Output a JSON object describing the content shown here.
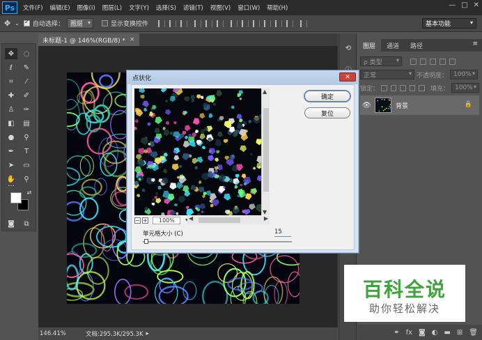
{
  "app": {
    "logo": "Ps"
  },
  "menu": [
    "文件(F)",
    "编辑(E)",
    "图像(I)",
    "图层(L)",
    "文字(Y)",
    "选择(S)",
    "滤镜(T)",
    "视图(V)",
    "窗口(W)",
    "帮助(H)"
  ],
  "window_controls": {
    "minimize": "—",
    "maximize": "□",
    "close": "✕"
  },
  "options": {
    "auto_select_label": "自动选择：",
    "auto_select_checked": true,
    "auto_select_target": "图层",
    "show_transform_label": "显示变换控件",
    "show_transform_checked": false,
    "workspace": "基本功能"
  },
  "document": {
    "tab_title": "未标题-1 @ 146%(RGB/8) *",
    "tab_close": "×"
  },
  "status": {
    "zoom": "146.41%",
    "doc_info": "文档:295.3K/295.3K",
    "arrow": "▸"
  },
  "layers_panel": {
    "tabs": [
      "图层",
      "通道",
      "路径"
    ],
    "active_tab": "图层",
    "menu_icon": "≡",
    "filter_placeholder": "ρ 类型",
    "blend_mode": "正常",
    "opacity_label": "不透明度：",
    "opacity_value": "100%",
    "lock_label": "锁定：",
    "fill_label": "填充：",
    "fill_value": "100%",
    "layer": {
      "name": "背景",
      "visible": true,
      "locked": true
    }
  },
  "watermark": {
    "title": "百科全说",
    "subtitle": "助你轻松解决"
  },
  "dialog": {
    "title": "点状化",
    "close_label": "✕",
    "ok_label": "确定",
    "reset_label": "复位",
    "zoom_minus": "−",
    "zoom_plus": "+",
    "zoom_value": "100%",
    "cell_size_label": "单元格大小 (C)",
    "cell_size_value": "15",
    "scroll_up": "▲",
    "scroll_down": "▼",
    "scroll_left": "◀",
    "scroll_right": "▶"
  },
  "colors": {
    "foreground": "#ffffff",
    "background": "#000000",
    "accent_watermark": "#3da33a"
  }
}
